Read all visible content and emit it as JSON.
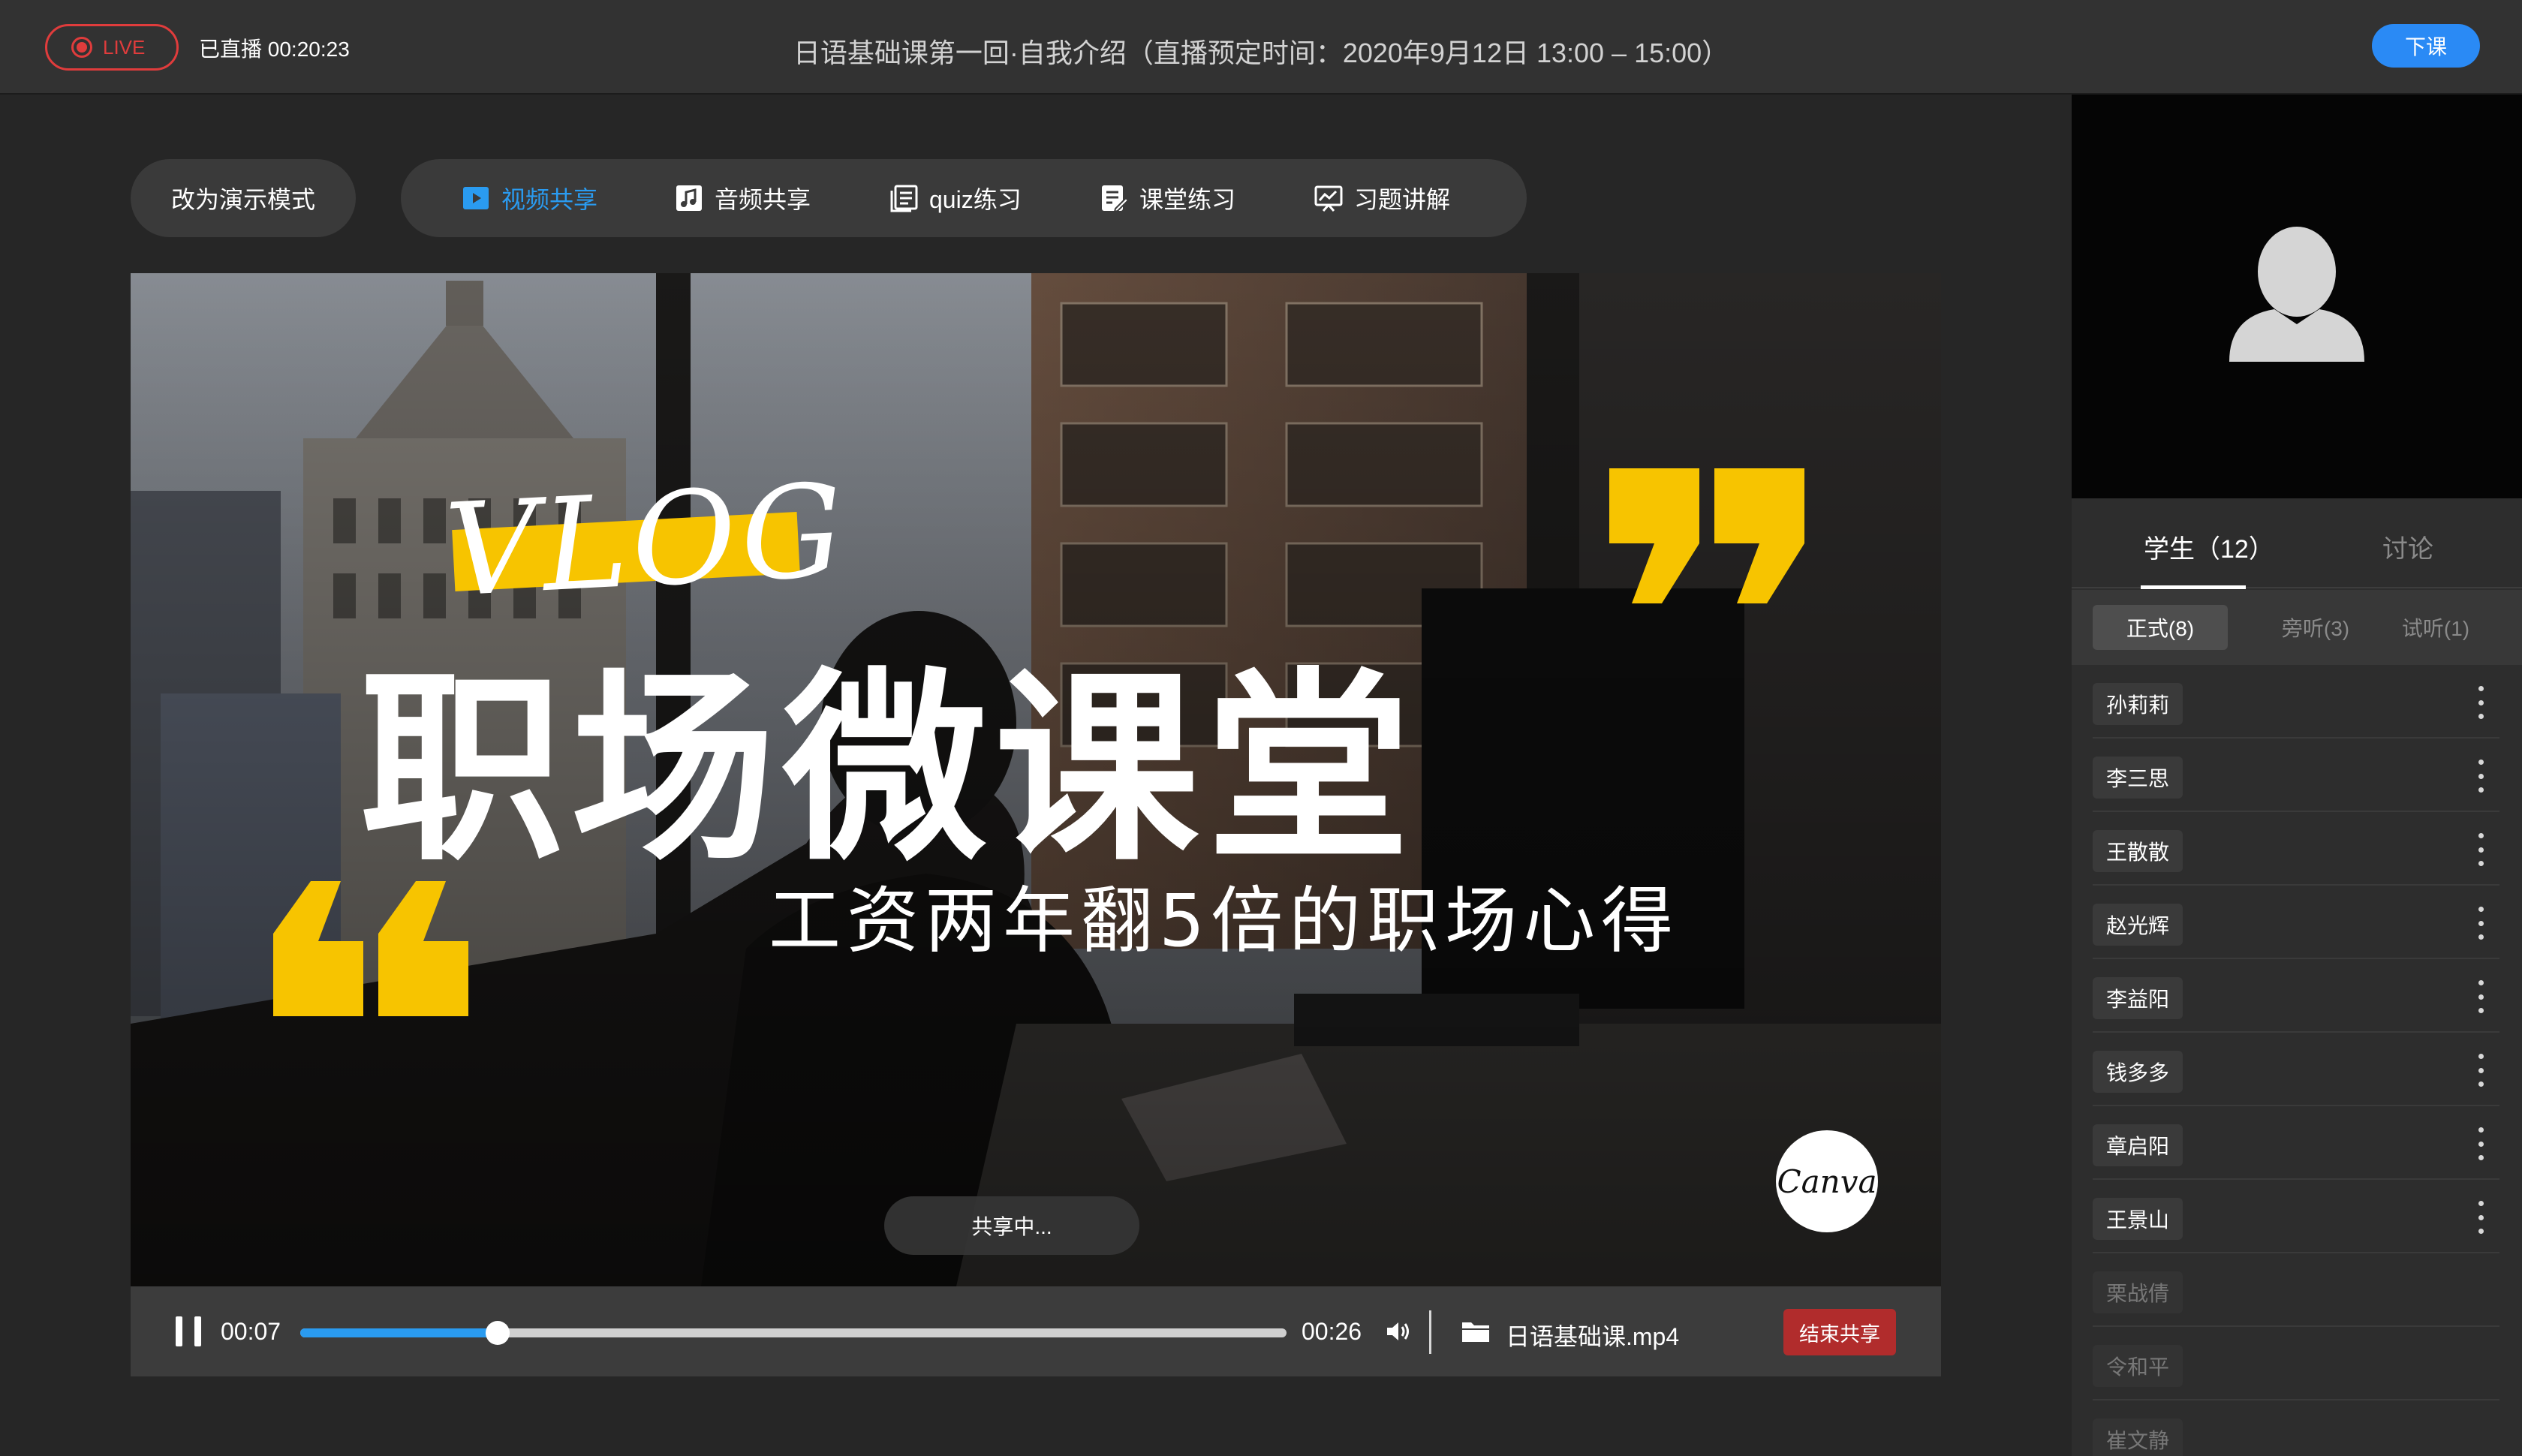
{
  "header": {
    "live_label": "LIVE",
    "elapsed": "已直播 00:20:23",
    "course_title": "日语基础课第一回·自我介绍（直播预定时间：2020年9月12日 13:00 – 15:00）",
    "end_class_label": "下课"
  },
  "toolbar": {
    "mode_button": "改为演示模式",
    "tools": [
      {
        "label": "视频共享",
        "icon": "video-share-icon",
        "active": true
      },
      {
        "label": "音频共享",
        "icon": "music-note-icon",
        "active": false
      },
      {
        "label": "quiz练习",
        "icon": "quiz-icon",
        "active": false
      },
      {
        "label": "课堂练习",
        "icon": "edit-document-icon",
        "active": false
      },
      {
        "label": "习题讲解",
        "icon": "presentation-icon",
        "active": false
      }
    ]
  },
  "video": {
    "vlog_text": "VLOG",
    "headline": "职场微课堂",
    "subline": "工资两年翻5倍的职场心得",
    "brand": "Canva",
    "sharing_status": "共享中..."
  },
  "player": {
    "current_time": "00:07",
    "total_time": "00:26",
    "progress": 0.2,
    "filename": "日语基础课.mp4",
    "stop_share_label": "结束共享"
  },
  "sidebar": {
    "tabs": [
      "学生（12）",
      "讨论"
    ],
    "subtabs": [
      "正式(8)",
      "旁听(3)",
      "试听(1)"
    ],
    "students": [
      {
        "name": "孙莉莉",
        "online": true
      },
      {
        "name": "李三思",
        "online": true
      },
      {
        "name": "王散散",
        "online": true
      },
      {
        "name": "赵光辉",
        "online": true
      },
      {
        "name": "李益阳",
        "online": true
      },
      {
        "name": "钱多多",
        "online": true
      },
      {
        "name": "章启阳",
        "online": true
      },
      {
        "name": "王景山",
        "online": true
      },
      {
        "name": "栗战倩",
        "online": false
      },
      {
        "name": "令和平",
        "online": false
      },
      {
        "name": "崔文静",
        "online": false
      }
    ]
  },
  "colors": {
    "accent": "#2a9bf0",
    "live_red": "#e03c3c",
    "quote_yellow": "#f7c400",
    "stop_red": "#b12c2c"
  }
}
